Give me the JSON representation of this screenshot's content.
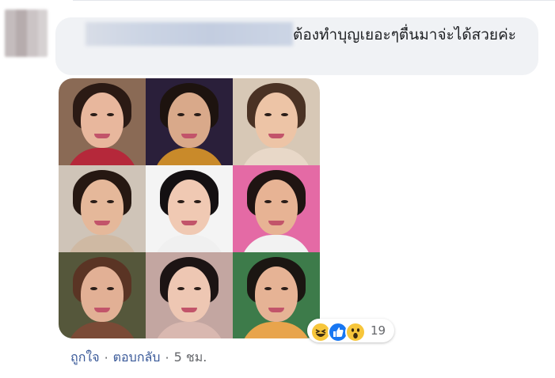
{
  "comment": {
    "text": "ต้องทำบุญเยอะๆตื่นมาจ่ะได้สวยค่ะ",
    "reactions": {
      "icons": [
        "haha-icon",
        "like-icon",
        "wow-icon"
      ],
      "count": "19"
    },
    "actions": {
      "like_label": "ถูกใจ",
      "reply_label": "ตอบกลับ",
      "separator": "·",
      "time": "5 ชม."
    }
  },
  "photos": [
    {
      "bg": "#8a6a55",
      "hair": "#2b1a14",
      "skin": "#e8b79d",
      "top": "#b5283a"
    },
    {
      "bg": "#2a1f3a",
      "hair": "#1d130f",
      "skin": "#d9a98a",
      "top": "#c98a2a"
    },
    {
      "bg": "#d7c8b6",
      "hair": "#4a3224",
      "skin": "#edc4a6",
      "top": "#e8d8c8"
    },
    {
      "bg": "#cfc4b8",
      "hair": "#261812",
      "skin": "#e5b89a",
      "top": "#cfb9a3"
    },
    {
      "bg": "#f4f4f4",
      "hair": "#141012",
      "skin": "#f0c9b3",
      "top": "#f0f0f0"
    },
    {
      "bg": "#e46aa5",
      "hair": "#1f1412",
      "skin": "#e7b394",
      "top": "#f2f2f2"
    },
    {
      "bg": "#55573b",
      "hair": "#5a3424",
      "skin": "#e2b095",
      "top": "#7a4a36"
    },
    {
      "bg": "#c3a6a1",
      "hair": "#1c1414",
      "skin": "#eec7b3",
      "top": "#d9b8b0"
    },
    {
      "bg": "#3d7b4a",
      "hair": "#1b1612",
      "skin": "#e6b395",
      "top": "#e8a44c"
    }
  ]
}
